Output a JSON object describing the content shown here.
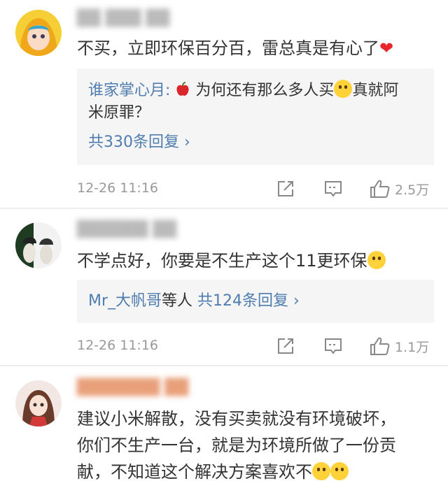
{
  "comments": [
    {
      "text": "不买，立即环保百分百，雷总真是有心了",
      "reply": {
        "user": "谁家掌心月:",
        "text_line1": "为何还有那么多人买",
        "text_line1b": "真就阿",
        "text_line2": "米原罪？",
        "more": "共330条回复 ›"
      },
      "time": "12-26 11:16",
      "likes": "2.5万"
    },
    {
      "text": "不学点好，你要是不生产这个11更环保",
      "reply": {
        "users": "Mr_大帆哥",
        "etc": "等人",
        "more": "共124条回复 ›"
      },
      "time": "12-26 11:16",
      "likes": "1.1万"
    },
    {
      "text_line1": "建议小米解散，没有买卖就没有环境破坏，",
      "text_line2": "你们不生产一台，就是为环境所做了一份贡",
      "text_line3": "献，不知道这个解决方案喜欢不"
    }
  ],
  "icons": {
    "heart": "heart-icon",
    "apple": "apple-icon",
    "smile": "smile-emoji-icon",
    "repost": "repost-icon",
    "comment": "comment-icon",
    "like": "like-icon"
  },
  "colors": {
    "link": "#507daf",
    "meta": "#999999",
    "reply_bg": "#f5f5f5"
  }
}
